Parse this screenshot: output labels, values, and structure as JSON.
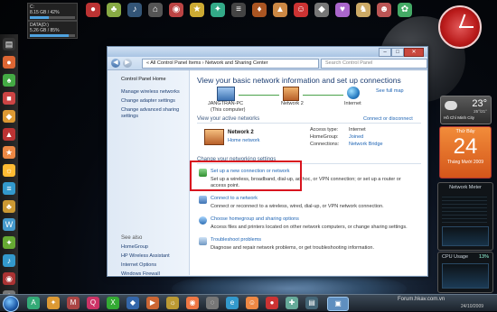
{
  "desktop": {
    "drives": [
      {
        "name": "C:",
        "info": "8.15 GB / 42%",
        "percent": 42
      },
      {
        "name": "DATA(D:)",
        "info": "5.26 GB / 85%",
        "percent": 85
      }
    ]
  },
  "window": {
    "address": "« All Control Panel Items › Network and Sharing Center",
    "search_placeholder": "Search Control Panel",
    "sidebar": {
      "home": "Control Panel Home",
      "links": [
        "Manage wireless networks",
        "Change adapter settings",
        "Change advanced sharing settings"
      ],
      "see_also_title": "See also",
      "see_also": [
        "HomeGroup",
        "HP Wireless Assistant",
        "Internet Options",
        "Windows Firewall"
      ]
    },
    "main": {
      "heading": "View your basic network information and set up connections",
      "see_full_map": "See full map",
      "map": {
        "pc": "JANGTRAN-PC",
        "pc_sub": "(This computer)",
        "network": "Network 2",
        "internet": "Internet"
      },
      "active_title": "View your active networks",
      "connect_disconnect": "Connect or disconnect",
      "active_network": {
        "name": "Network 2",
        "type": "Home network"
      },
      "props": {
        "access_type_label": "Access type:",
        "access_type": "Internet",
        "homegroup_label": "HomeGroup:",
        "homegroup": "Joined",
        "connections_label": "Connections:",
        "connections": "Network Bridge"
      },
      "change_title": "Change your networking settings",
      "tasks": [
        {
          "title": "Set up a new connection or network",
          "desc": "Set up a wireless, broadband, dial-up, ad hoc, or VPN connection; or set up a router or access point."
        },
        {
          "title": "Connect to a network",
          "desc": "Connect or reconnect to a wireless, wired, dial-up, or VPN network connection."
        },
        {
          "title": "Choose homegroup and sharing options",
          "desc": "Access files and printers located on other network computers, or change sharing settings."
        },
        {
          "title": "Troubleshoot problems",
          "desc": "Diagnose and repair network problems, or get troubleshooting information."
        }
      ]
    }
  },
  "gadgets": {
    "weather_temp": "23°",
    "weather_range": "25°/21°",
    "weather_city": "Hồ Chí Minh City",
    "cal_day": "Thứ Bảy",
    "cal_date": "24",
    "cal_month": "Tháng Mười 2009",
    "meter_title": "Network Meter",
    "cpu_title": "CPU Usage",
    "cpu_value": "13%"
  },
  "taskbar": {
    "forum": "Forum.hkav.com.vn",
    "date": "24/10/2009"
  },
  "colors": {
    "accent": "#1e64b4",
    "highlight_box": "#d8141e",
    "calendar": "#e07030"
  }
}
